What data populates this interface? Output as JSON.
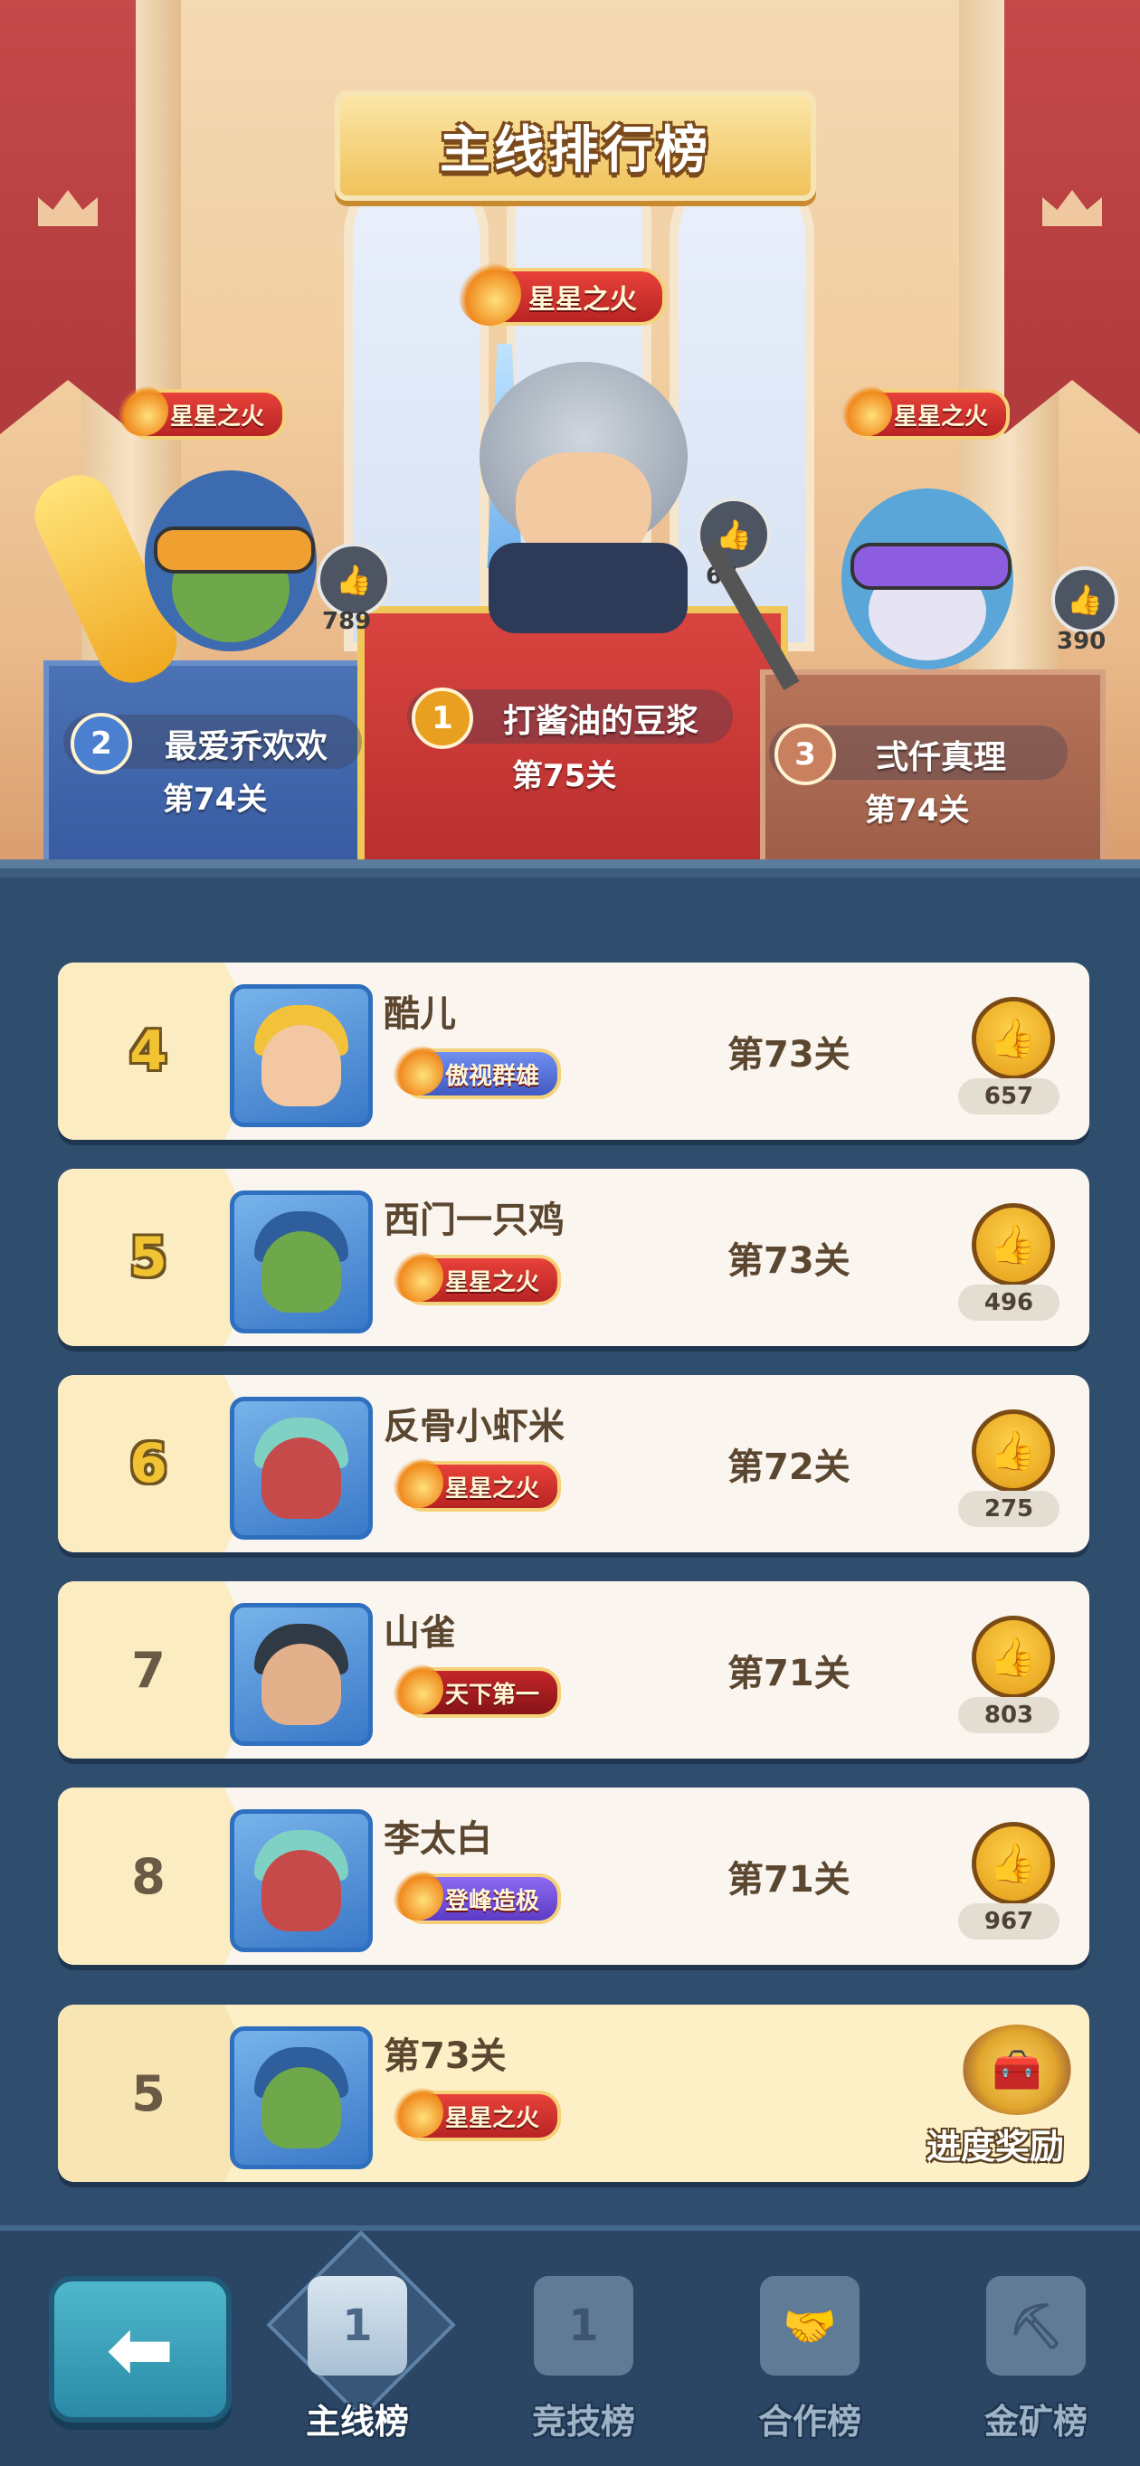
{
  "header": {
    "title": "主线排行榜"
  },
  "podium": {
    "first": {
      "rank": "1",
      "name": "打酱油的豆浆",
      "level": "第75关",
      "title_badge": "星星之火",
      "likes": "65"
    },
    "second": {
      "rank": "2",
      "name": "最爱乔欢欢",
      "level": "第74关",
      "title_badge": "星星之火",
      "likes": "789"
    },
    "third": {
      "rank": "3",
      "name": "弍仟真理",
      "level": "第74关",
      "title_badge": "星星之火",
      "likes": "390"
    }
  },
  "list": [
    {
      "rank": "4",
      "name": "酷儿",
      "badge": "傲视群雄",
      "level": "第73关",
      "likes": "657"
    },
    {
      "rank": "5",
      "name": "西门一只鸡",
      "badge": "星星之火",
      "level": "第73关",
      "likes": "496"
    },
    {
      "rank": "6",
      "name": "反骨小虾米",
      "badge": "星星之火",
      "level": "第72关",
      "likes": "275"
    },
    {
      "rank": "7",
      "name": "山雀",
      "badge": "天下第一",
      "level": "第71关",
      "likes": "803"
    },
    {
      "rank": "8",
      "name": "李太白",
      "badge": "登峰造极",
      "level": "第71关",
      "likes": "967"
    }
  ],
  "my_rank": {
    "rank": "5",
    "level": "第73关",
    "badge": "星星之火",
    "reward_label": "进度奖励"
  },
  "nav": {
    "back_icon": "arrow-left-icon",
    "tabs": [
      {
        "label": "主线榜",
        "icon": "podium-icon",
        "icon_text": "1",
        "active": true
      },
      {
        "label": "竞技榜",
        "icon": "trophy-icon",
        "icon_text": "1",
        "active": false
      },
      {
        "label": "合作榜",
        "icon": "handshake-icon",
        "icon_text": "",
        "active": false
      },
      {
        "label": "金矿榜",
        "icon": "minecart-icon",
        "icon_text": "",
        "active": false
      }
    ]
  },
  "colors": {
    "gold": "#f1c232",
    "panel": "#2f4d6d",
    "row_bg": "#faf6ef",
    "title_red": "#e8413a"
  }
}
